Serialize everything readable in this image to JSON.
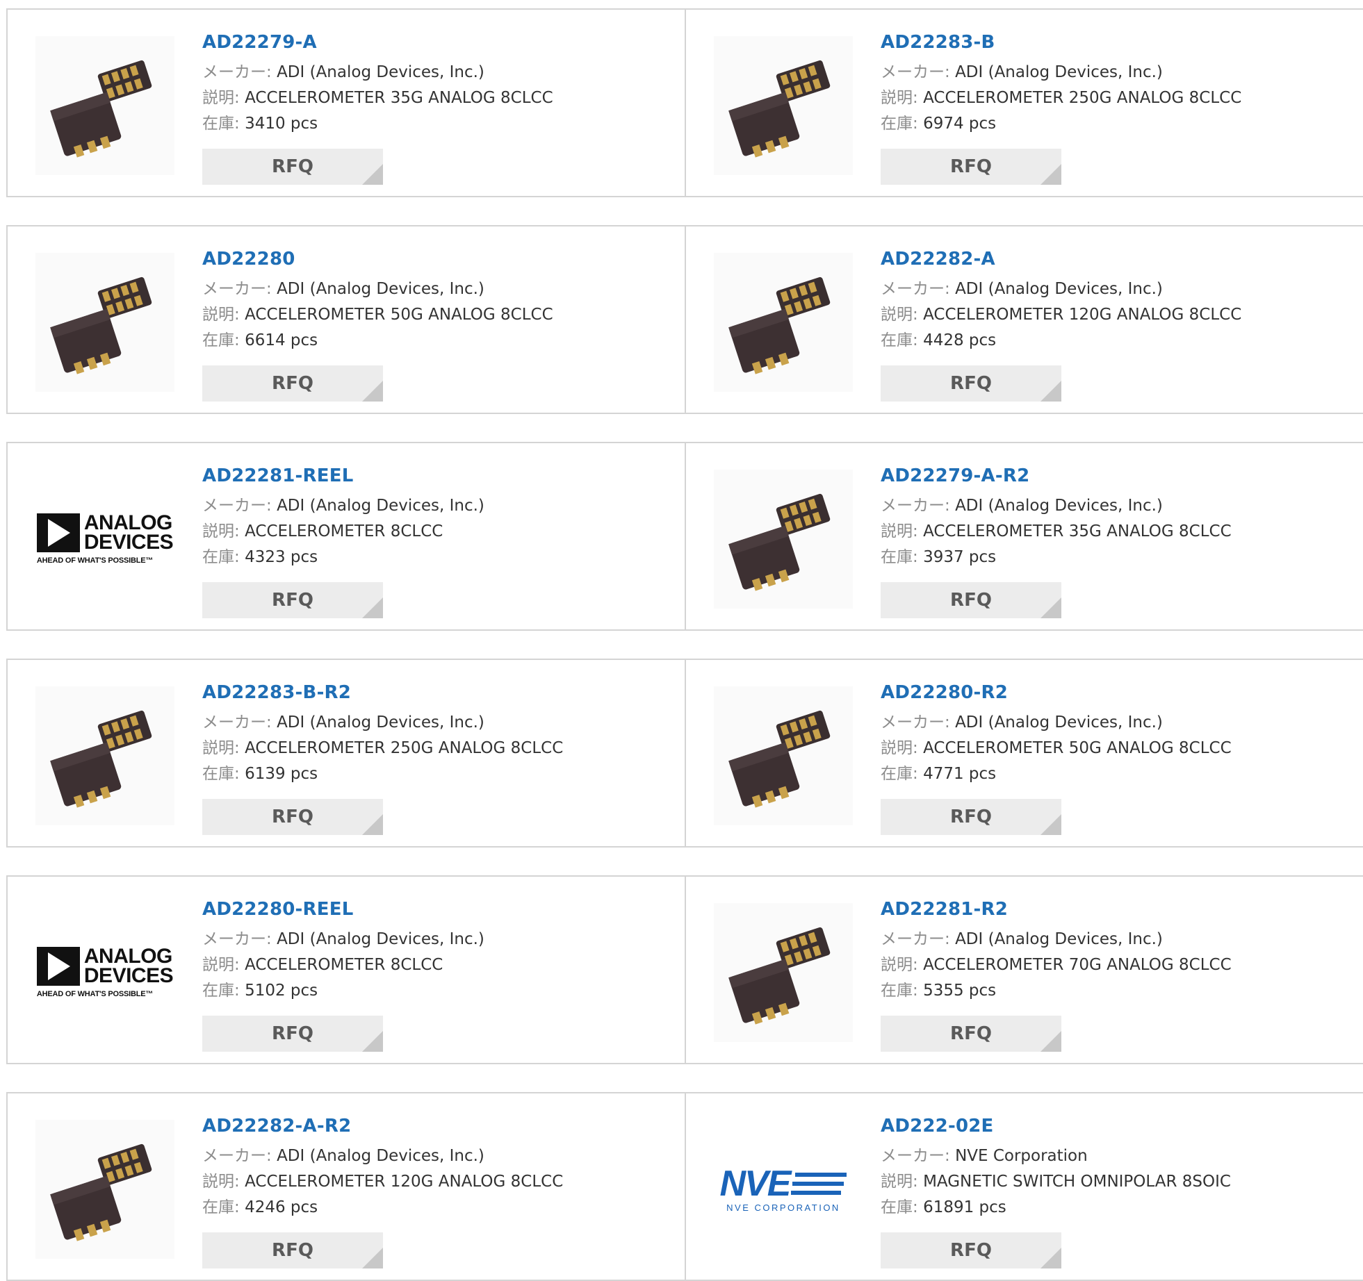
{
  "labels": {
    "maker": "メーカー:",
    "desc": "説明:",
    "stock": "在庫:",
    "rfq": "RFQ"
  },
  "colors": {
    "link": "#1f6eb5",
    "border": "#d4d4d4",
    "button_bg": "#ececec",
    "label": "#8c8c8c"
  },
  "products": [
    {
      "part": "AD22279-A",
      "maker": "ADI (Analog Devices, Inc.)",
      "desc": "ACCELEROMETER 35G ANALOG 8CLCC",
      "stock": "3410 pcs",
      "image": "chip-icon"
    },
    {
      "part": "AD22283-B",
      "maker": "ADI (Analog Devices, Inc.)",
      "desc": "ACCELEROMETER 250G ANALOG 8CLCC",
      "stock": "6974 pcs",
      "image": "chip-icon"
    },
    {
      "part": "AD22280",
      "maker": "ADI (Analog Devices, Inc.)",
      "desc": "ACCELEROMETER 50G ANALOG 8CLCC",
      "stock": "6614 pcs",
      "image": "chip-icon"
    },
    {
      "part": "AD22282-A",
      "maker": "ADI (Analog Devices, Inc.)",
      "desc": "ACCELEROMETER 120G ANALOG 8CLCC",
      "stock": "4428 pcs",
      "image": "chip-icon"
    },
    {
      "part": "AD22281-REEL",
      "maker": "ADI (Analog Devices, Inc.)",
      "desc": "ACCELEROMETER 8CLCC",
      "stock": "4323 pcs",
      "image": "analog-devices-logo",
      "logo_text": [
        "ANALOG",
        "DEVICES",
        "AHEAD OF WHAT'S POSSIBLE™"
      ]
    },
    {
      "part": "AD22279-A-R2",
      "maker": "ADI (Analog Devices, Inc.)",
      "desc": "ACCELEROMETER 35G ANALOG 8CLCC",
      "stock": "3937 pcs",
      "image": "chip-icon"
    },
    {
      "part": "AD22283-B-R2",
      "maker": "ADI (Analog Devices, Inc.)",
      "desc": "ACCELEROMETER 250G ANALOG 8CLCC",
      "stock": "6139 pcs",
      "image": "chip-icon"
    },
    {
      "part": "AD22280-R2",
      "maker": "ADI (Analog Devices, Inc.)",
      "desc": "ACCELEROMETER 50G ANALOG 8CLCC",
      "stock": "4771 pcs",
      "image": "chip-icon"
    },
    {
      "part": "AD22280-REEL",
      "maker": "ADI (Analog Devices, Inc.)",
      "desc": "ACCELEROMETER 8CLCC",
      "stock": "5102 pcs",
      "image": "analog-devices-logo",
      "logo_text": [
        "ANALOG",
        "DEVICES",
        "AHEAD OF WHAT'S POSSIBLE™"
      ]
    },
    {
      "part": "AD22281-R2",
      "maker": "ADI (Analog Devices, Inc.)",
      "desc": "ACCELEROMETER 70G ANALOG 8CLCC",
      "stock": "5355 pcs",
      "image": "chip-icon"
    },
    {
      "part": "AD22282-A-R2",
      "maker": "ADI (Analog Devices, Inc.)",
      "desc": "ACCELEROMETER 120G ANALOG 8CLCC",
      "stock": "4246 pcs",
      "image": "chip-icon"
    },
    {
      "part": "AD222-02E",
      "maker": "NVE Corporation",
      "desc": "MAGNETIC SWITCH OMNIPOLAR 8SOIC",
      "stock": "61891 pcs",
      "image": "nve-logo",
      "logo_text": [
        "NVE",
        "NVE CORPORATION"
      ]
    }
  ]
}
